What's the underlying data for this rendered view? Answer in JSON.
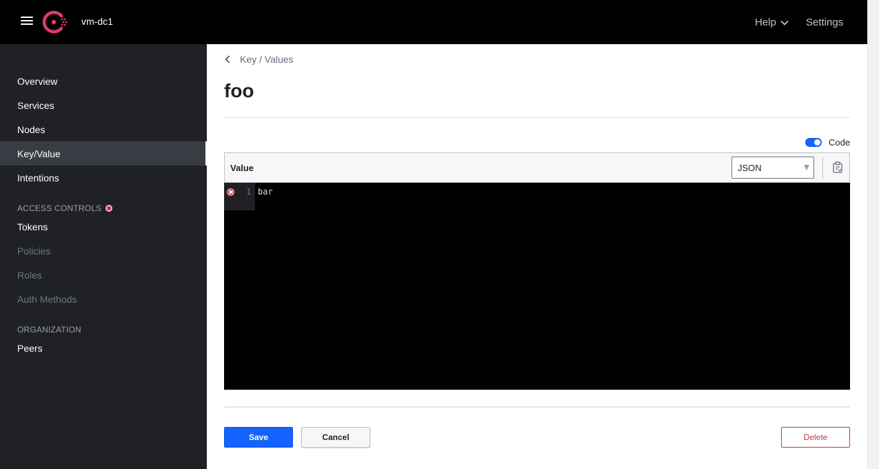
{
  "header": {
    "datacenter": "vm-dc1",
    "help_label": "Help",
    "settings_label": "Settings"
  },
  "sidebar": {
    "items": [
      {
        "label": "Overview"
      },
      {
        "label": "Services"
      },
      {
        "label": "Nodes"
      },
      {
        "label": "Key/Value"
      },
      {
        "label": "Intentions"
      }
    ],
    "access_controls": {
      "heading": "ACCESS CONTROLS",
      "items": [
        {
          "label": "Tokens"
        },
        {
          "label": "Policies"
        },
        {
          "label": "Roles"
        },
        {
          "label": "Auth Methods"
        }
      ]
    },
    "organization": {
      "heading": "ORGANIZATION",
      "items": [
        {
          "label": "Peers"
        }
      ]
    },
    "active_item": "Key/Value"
  },
  "main": {
    "breadcrumb": "Key / Values",
    "title": "foo",
    "code_toggle_label": "Code",
    "code_toggle_on": true,
    "editor": {
      "label": "Value",
      "language": "JSON",
      "lines": [
        {
          "number": "1",
          "text": "bar"
        }
      ]
    },
    "buttons": {
      "save": "Save",
      "cancel": "Cancel",
      "delete": "Delete"
    }
  },
  "colors": {
    "accent": "#1563ff",
    "brand": "#e03875",
    "danger": "#c73445",
    "sidebar_bg": "#1f2124"
  }
}
